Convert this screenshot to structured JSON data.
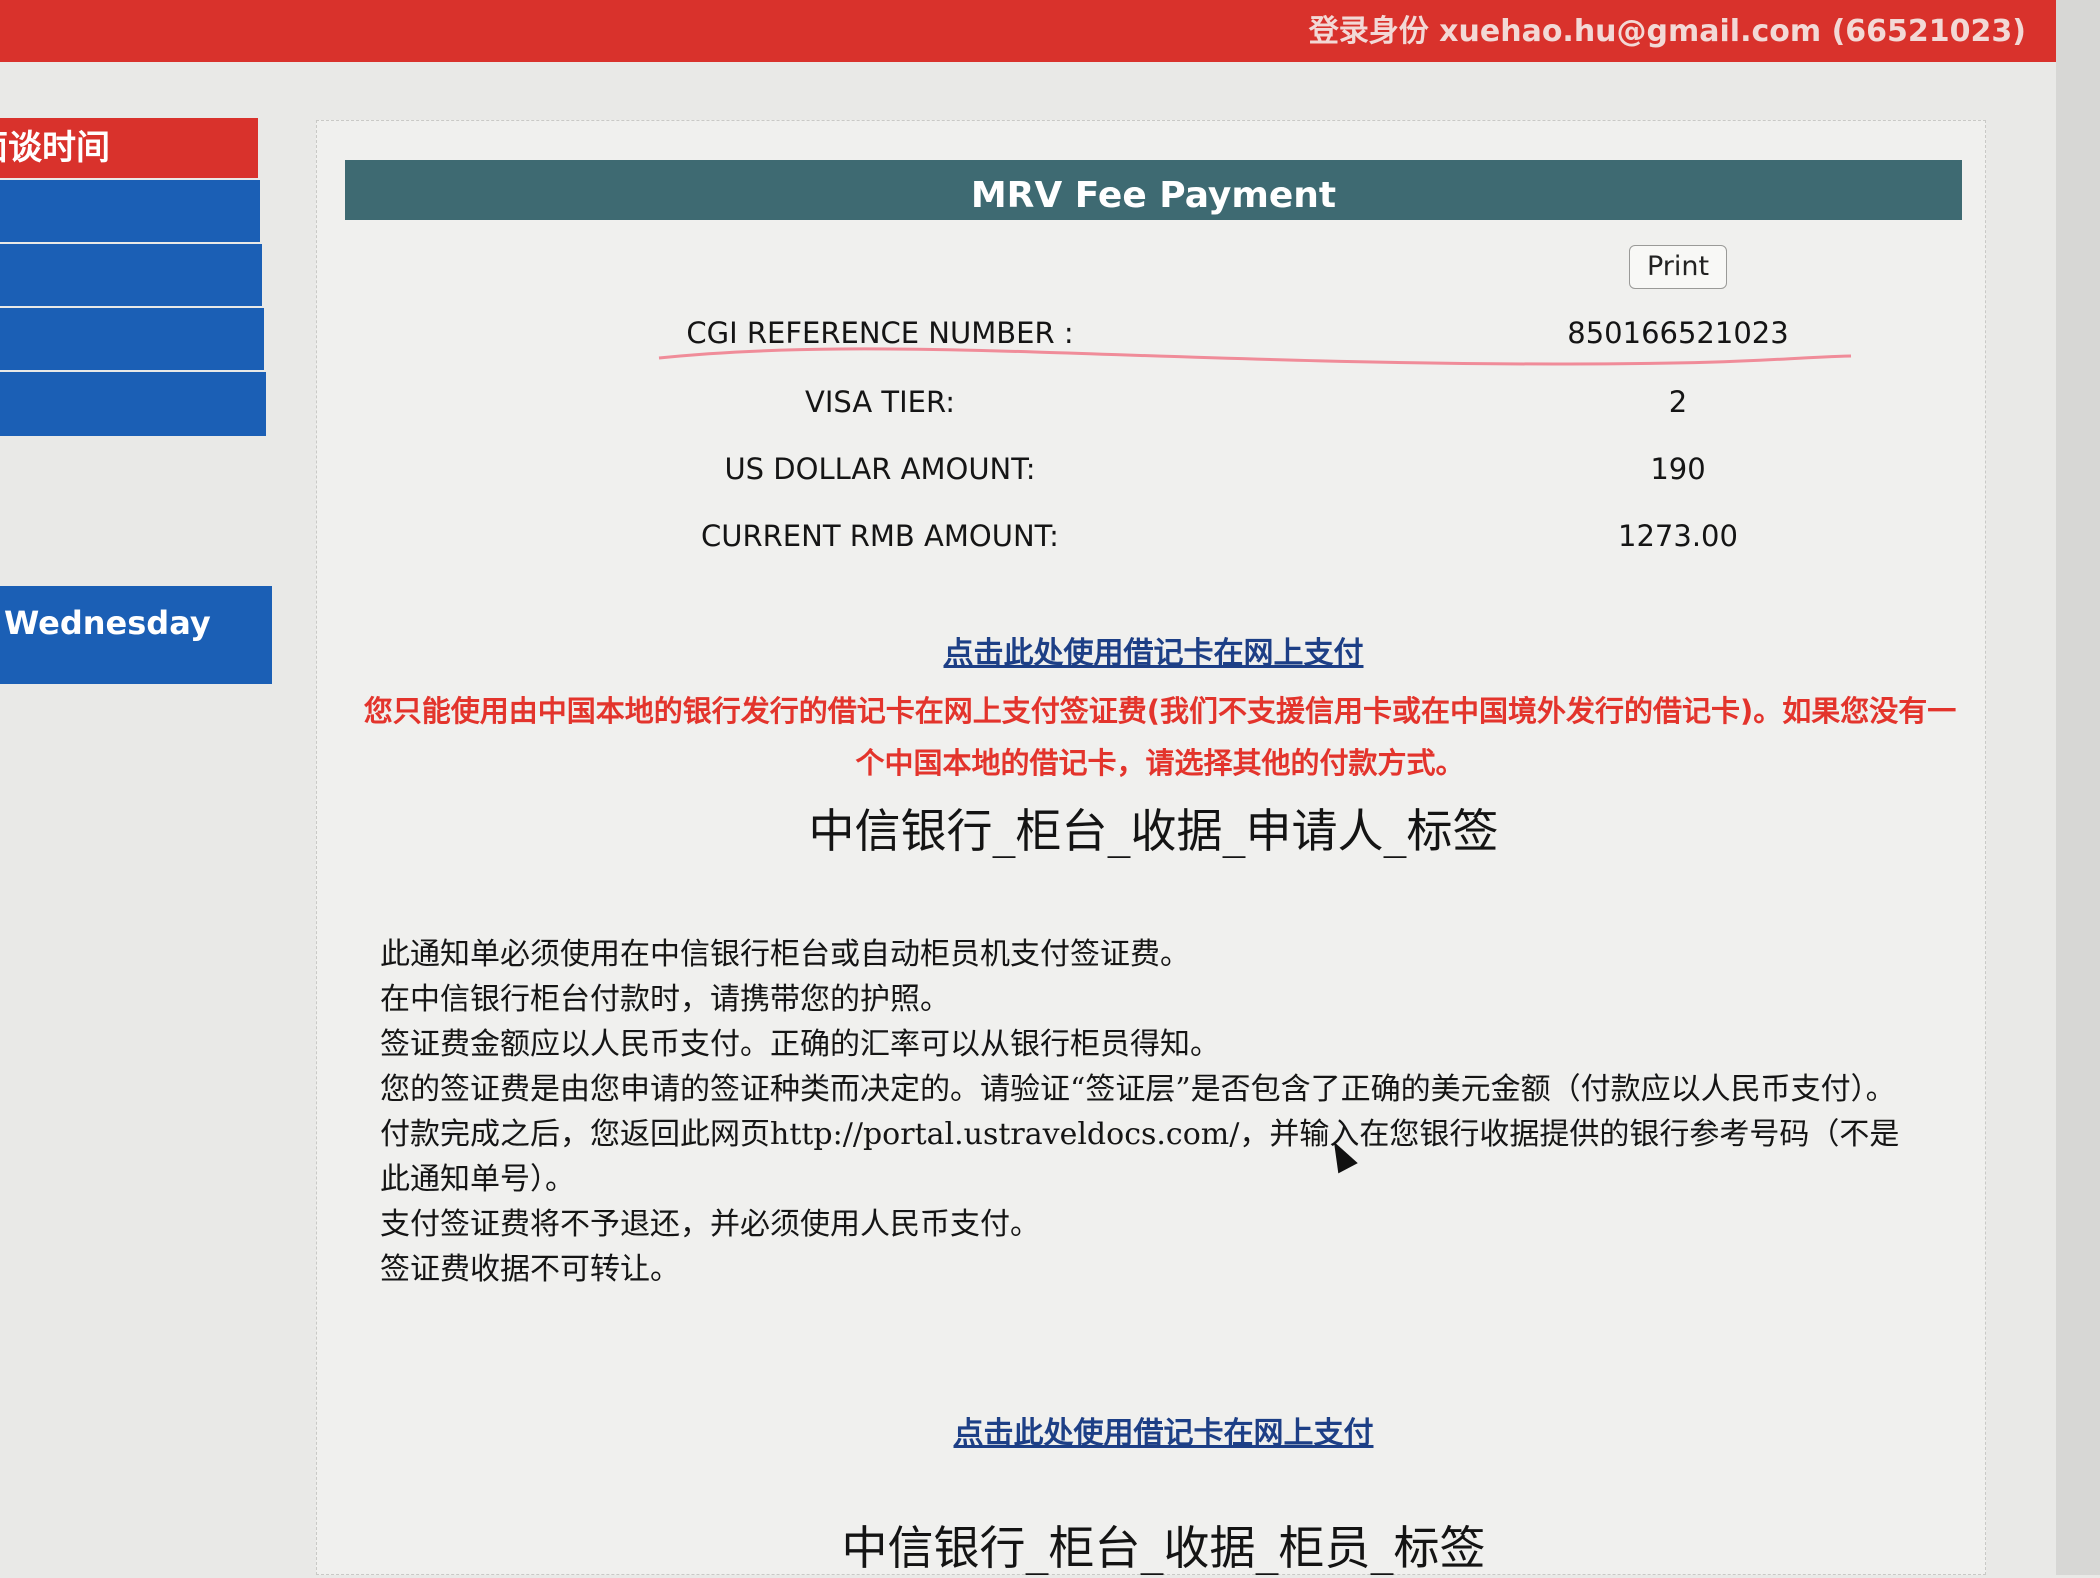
{
  "header": {
    "login_label": "登录身份",
    "login_user": "xuehao.hu@gmail.com (66521023)"
  },
  "sidebar": {
    "header_label": "面谈时间",
    "day_label": "Wednesday"
  },
  "payment": {
    "title": "MRV Fee Payment",
    "print_label": "Print",
    "rows": [
      {
        "label": "CGI REFERENCE NUMBER :",
        "value": "850166521023"
      },
      {
        "label": "VISA TIER:",
        "value": "2"
      },
      {
        "label": "US DOLLAR AMOUNT:",
        "value": "190"
      },
      {
        "label": "CURRENT RMB AMOUNT:",
        "value": "1273.00"
      }
    ],
    "pay_link": "点击此处使用借记卡在网上支付",
    "warning": "您只能使用由中国本地的银行发行的借记卡在网上支付签证费(我们不支援信用卡或在中国境外发行的借记卡)。如果您没有一个中国本地的借记卡，请选择其他的付款方式。",
    "section_title_1": "中信银行_柜台_收据_申请人_标签",
    "notice_lines": [
      "此通知单必须使用在中信银行柜台或自动柜员机支付签证费。",
      "在中信银行柜台付款时，请携带您的护照。",
      "签证费金额应以人民币支付。正确的汇率可以从银行柜员得知。",
      "您的签证费是由您申请的签证种类而决定的。请验证“签证层”是否包含了正确的美元金额（付款应以人民币支付）。",
      "付款完成之后，您返回此网页http://portal.ustraveldocs.com/，并输入在您银行收据提供的银行参考号码（不是此通知单号）。",
      "支付签证费将不予退还，并必须使用人民币支付。",
      "签证费收据不可转让。"
    ],
    "pay_link_2": "点击此处使用借记卡在网上支付",
    "section_title_2": "中信银行_柜台_收据_柜员_标签"
  },
  "colors": {
    "header_red": "#d9322c",
    "sidebar_blue": "#1b5fb5",
    "title_bar_teal": "#3e6a72",
    "warning_red": "#e3342c",
    "link_blue": "#1d3f86",
    "pen_mark_pink": "#f07a8a"
  },
  "icons": {
    "cursor": "mouse-pointer-icon"
  }
}
